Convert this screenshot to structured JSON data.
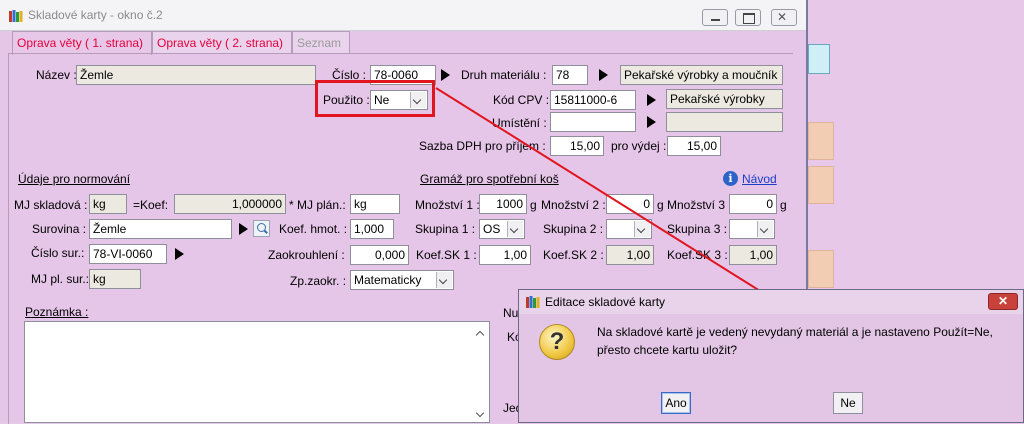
{
  "window": {
    "title": "Skladové karty - okno č.2"
  },
  "tabs": [
    {
      "label": "Oprava věty ( 1. strana)"
    },
    {
      "label": "Oprava věty ( 2. strana)"
    },
    {
      "label": "Seznam"
    }
  ],
  "form": {
    "nazev": {
      "label": "Název :",
      "value": "Žemle"
    },
    "cislo": {
      "label": "Číslo :",
      "value": "78-0060"
    },
    "druh_materialu": {
      "label": "Druh materiálu :",
      "code": "78",
      "name": "Pekařské výrobky a moučník"
    },
    "pouzito": {
      "label": "Použito :",
      "value": "Ne"
    },
    "kod_cpv": {
      "label": "Kód CPV :",
      "code": "15811000-6",
      "name": "Pekařské výrobky"
    },
    "umisteni": {
      "label": "Umístění :",
      "value": ""
    },
    "sazba_dph": {
      "label": "Sazba DPH pro příjem :",
      "prijem": "15,00",
      "vydej_label": "pro výdej :",
      "vydej": "15,00"
    }
  },
  "normovani": {
    "section": "Údaje pro normování",
    "mj_skladova": {
      "label": "MJ skladová :",
      "value": "kg"
    },
    "koef": {
      "label": "=Koef:",
      "value": "1,000000"
    },
    "mj_plan": {
      "label": "* MJ plán.:",
      "value": "kg"
    },
    "surovina": {
      "label": "Surovina :",
      "value": "Žemle"
    },
    "koef_hmot": {
      "label": "Koef. hmot. :",
      "value": "1,000"
    },
    "cislo_sur": {
      "label": "Číslo sur.:",
      "value": "78-VI-0060"
    },
    "zaokrouhleni": {
      "label": "Zaokrouhlení :",
      "value": "0,000"
    },
    "mj_pl_sur": {
      "label": "MJ pl. sur.:",
      "value": "kg"
    },
    "zp_zaokr": {
      "label": "Zp.zaokr. :",
      "value": "Matematicky"
    }
  },
  "gramaz": {
    "section": "Gramáž pro spotřební koš",
    "help_link": "Návod",
    "mnozstvi1": {
      "label": "Množství 1 :",
      "value": "1000",
      "unit": "g"
    },
    "mnozstvi2": {
      "label": "Množství 2 :",
      "value": "0",
      "unit": "g"
    },
    "mnozstvi3": {
      "label": "Množství 3 :",
      "value": "0",
      "unit": "g"
    },
    "skupina1": {
      "label": "Skupina 1 :",
      "value": "OS"
    },
    "skupina2": {
      "label": "Skupina 2 :",
      "value": ""
    },
    "skupina3": {
      "label": "Skupina 3 :",
      "value": ""
    },
    "koef_sk1": {
      "label": "Koef.SK 1 :",
      "value": "1,00"
    },
    "koef_sk2": {
      "label": "Koef.SK 2 :",
      "value": "1,00"
    },
    "koef_sk3": {
      "label": "Koef.SK 3 :",
      "value": "1,00"
    }
  },
  "poznamka": {
    "label": "Poznámka :",
    "value": ""
  },
  "partial_labels": {
    "nu": "Nu",
    "ko": "Kó",
    "je": "Jed"
  },
  "dialog": {
    "title": "Editace skladové karty",
    "message_line1": "Na skladové kartě je vedený nevydaný materiál a je nastaveno Použít=Ne,",
    "message_line2": "přesto chcete kartu uložit?",
    "yes": "Ano",
    "no": "Ne"
  },
  "colors": {
    "annotation_red": "#e1151e",
    "tab_text": "#e4003a",
    "link": "#1a3ec6"
  }
}
